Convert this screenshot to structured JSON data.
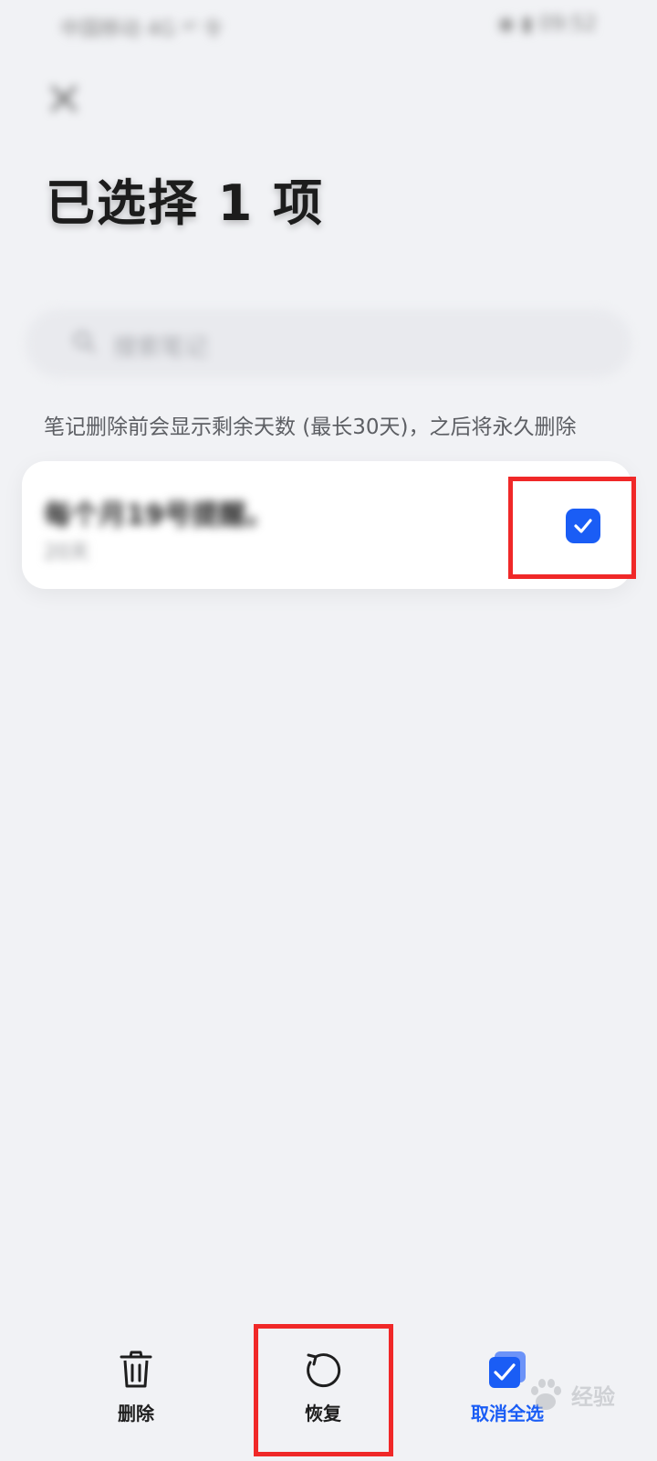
{
  "status_bar": {
    "left_text": "中国移动 4G ᵃˡˡ 令",
    "right_text": "◉ ▮ 09:52"
  },
  "header": {
    "close_icon": "close-icon",
    "title": "已选择 1 项"
  },
  "search": {
    "placeholder": "搜索笔记",
    "icon": "search-icon"
  },
  "info_text": "笔记删除前会显示剩余天数 (最长30天)，之后将永久删除",
  "note": {
    "title": "每个月19号提醒。",
    "subtitle": "20天",
    "checked": true
  },
  "actions": {
    "delete_label": "删除",
    "restore_label": "恢复",
    "unselect_label": "取消全选"
  },
  "watermark": {
    "text": "经验",
    "logo": "Bai du"
  },
  "colors": {
    "accent": "#1a5df5",
    "highlight": "#f02828",
    "background": "#f1f2f5"
  }
}
